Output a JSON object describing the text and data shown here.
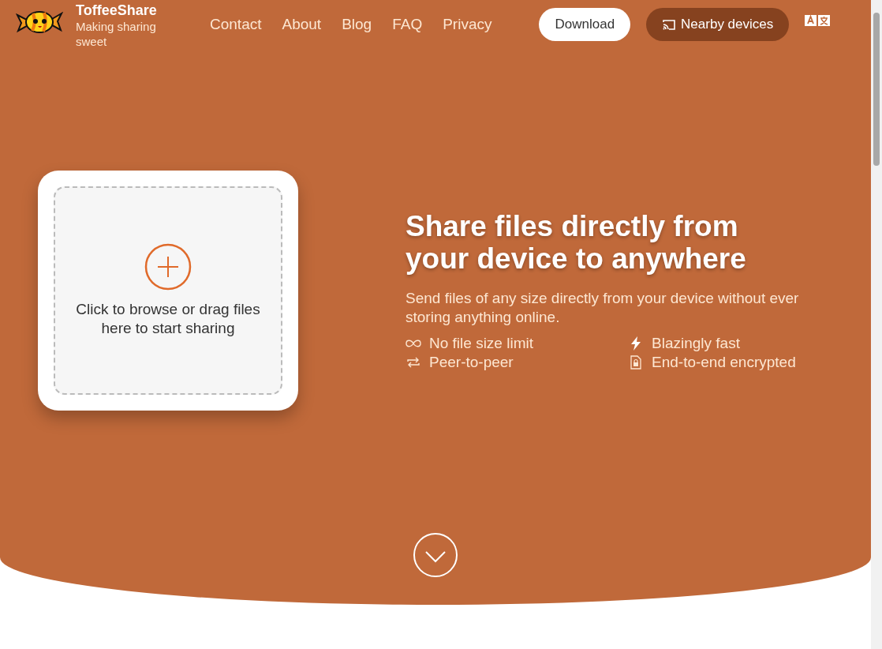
{
  "brand": {
    "name": "ToffeeShare",
    "tagline": "Making sharing sweet"
  },
  "nav": [
    "Contact",
    "About",
    "Blog",
    "FAQ",
    "Privacy"
  ],
  "download_button": "Download",
  "nearby_button": "Nearby devices",
  "dropzone": {
    "text": "Click to browse or drag files here to start sharing"
  },
  "hero": {
    "heading": "Share files directly from your device to anywhere",
    "subtitle": "Send files of any size directly from your device without ever storing anything online."
  },
  "features": [
    {
      "label": "No file size limit"
    },
    {
      "label": "Blazingly fast"
    },
    {
      "label": "Peer-to-peer"
    },
    {
      "label": "End-to-end encrypted"
    }
  ]
}
